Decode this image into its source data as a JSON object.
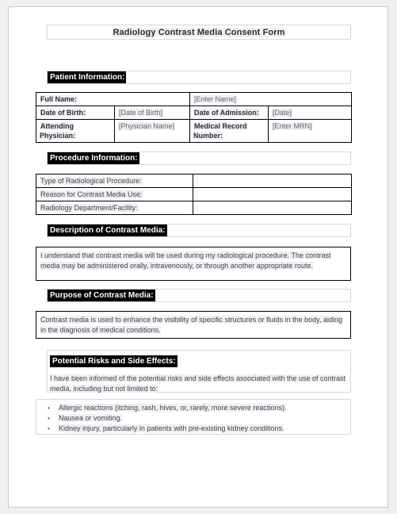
{
  "document": {
    "title": "Radiology Contrast Media Consent Form"
  },
  "sections": {
    "patient": {
      "heading": "Patient Information:",
      "rows": [
        {
          "label": "Full Name:",
          "label_value": "",
          "label2": "",
          "value2": "[Enter Name]"
        },
        {
          "label": "Date of Birth:",
          "label_value": "[Date of Birth]",
          "label2": "Date of Admission:",
          "value2": "[Date]"
        },
        {
          "label": "Attending Physician:",
          "label_value": "[Physician Name]",
          "label2": "Medical Record Number:",
          "value2": "[Enter MRN]"
        }
      ]
    },
    "procedure": {
      "heading": "Procedure Information:",
      "rows": [
        {
          "label": "Type of Radiological Procedure:",
          "value": ""
        },
        {
          "label": "Reason for Contrast Media Use:",
          "value": ""
        },
        {
          "label": "Radiology Department/Facility:",
          "value": ""
        }
      ]
    },
    "description": {
      "heading": "Description of Contrast Media:",
      "body": "I understand that contrast media will be used during my radiological procedure. The contrast media may be administered orally, intravenously, or through another appropriate route."
    },
    "purpose": {
      "heading": "Purpose of Contrast Media:",
      "body": "Contrast media is used to enhance the visibility of specific structures or fluids in the body, aiding in the diagnosis of medical conditions."
    },
    "risks": {
      "heading": "Potential Risks and Side Effects:",
      "intro": "I have been informed of the potential risks and side effects associated with the use of contrast media, including but not limited to:",
      "bullet_glyph": "•",
      "bullets": [
        "Allergic reactions (itching, rash, hives, or, rarely, more severe reactions).",
        "Nausea or vomiting.",
        "Kidney injury, particularly in patients with pre-existing kidney conditions."
      ]
    }
  },
  "colors": {
    "page_background": "#ffffff",
    "canvas_background": "#efefef",
    "text": "#3b4350",
    "heading_highlight": "#000000",
    "heading_text": "#ffffff",
    "table_border": "#000000",
    "light_border": "#d5d5de"
  }
}
